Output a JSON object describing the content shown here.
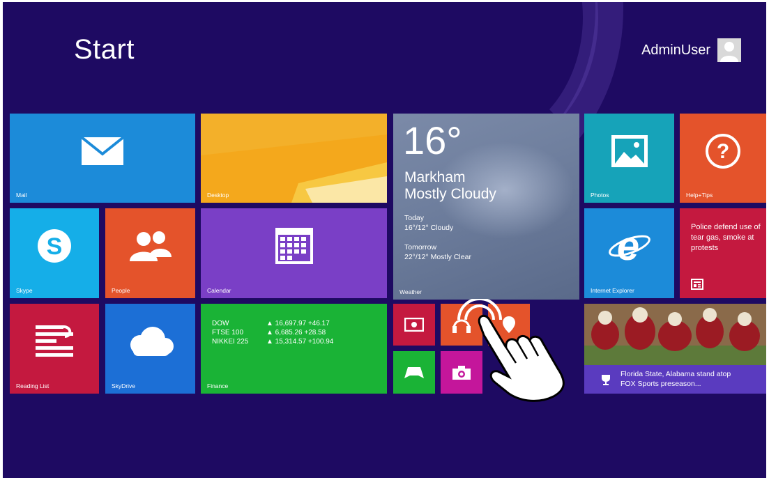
{
  "header": {
    "title": "Start",
    "user_name": "AdminUser"
  },
  "tiles": {
    "mail": {
      "label": "Mail",
      "icon": "envelope-icon",
      "color": "#1c8bd9"
    },
    "desktop": {
      "label": "Desktop",
      "color": "#f2a41b"
    },
    "weather": {
      "label": "Weather",
      "temp": "16°",
      "city": "Markham",
      "condition": "Mostly Cloudy",
      "today_label": "Today",
      "today_value": "16°/12° Cloudy",
      "tomorrow_label": "Tomorrow",
      "tomorrow_value": "22°/12° Mostly Clear"
    },
    "photos": {
      "label": "Photos",
      "icon": "picture-icon",
      "color": "#16a3b9"
    },
    "help": {
      "label": "Help+Tips",
      "icon": "question-icon",
      "color": "#e4532b"
    },
    "skype": {
      "label": "Skype",
      "icon": "skype-icon",
      "color": "#15aee8"
    },
    "people": {
      "label": "People",
      "icon": "people-icon",
      "color": "#e4532b"
    },
    "calendar": {
      "label": "Calendar",
      "icon": "calendar-icon",
      "color": "#7a3fc6"
    },
    "ie": {
      "label": "Internet Explorer",
      "icon": "ie-icon",
      "color": "#1c8bd9"
    },
    "news": {
      "headline": "Police defend use of tear gas, smoke at protests",
      "icon": "newspaper-icon",
      "color": "#c4193f"
    },
    "reading": {
      "label": "Reading List",
      "icon": "reading-list-icon",
      "color": "#c4193f"
    },
    "skydrive": {
      "label": "SkyDrive",
      "icon": "cloud-icon",
      "color": "#1c6fd6"
    },
    "finance": {
      "label": "Finance",
      "color": "#1ab336",
      "rows": [
        {
          "name": "DOW",
          "value": "▲ 16,697.97 +46.17"
        },
        {
          "name": "FTSE 100",
          "value": "▲ 6,685.26 +28.58"
        },
        {
          "name": "NIKKEI 225",
          "value": "▲ 15,314.57 +100.94"
        }
      ]
    },
    "video": {
      "icon": "video-icon",
      "color": "#c4193f"
    },
    "music": {
      "icon": "headphones-icon",
      "color": "#e4532b"
    },
    "maps": {
      "icon": "maps-icon",
      "color": "#e4532b"
    },
    "games": {
      "icon": "game-controller-icon",
      "color": "#1ab336"
    },
    "camera": {
      "icon": "camera-icon",
      "color": "#c4169b"
    },
    "sports": {
      "headline": "Florida State, Alabama stand atop FOX Sports preseason...",
      "icon": "trophy-icon",
      "color": "#5a3bbf"
    }
  },
  "overlay": {
    "icon": "hand-pointer-icon"
  }
}
